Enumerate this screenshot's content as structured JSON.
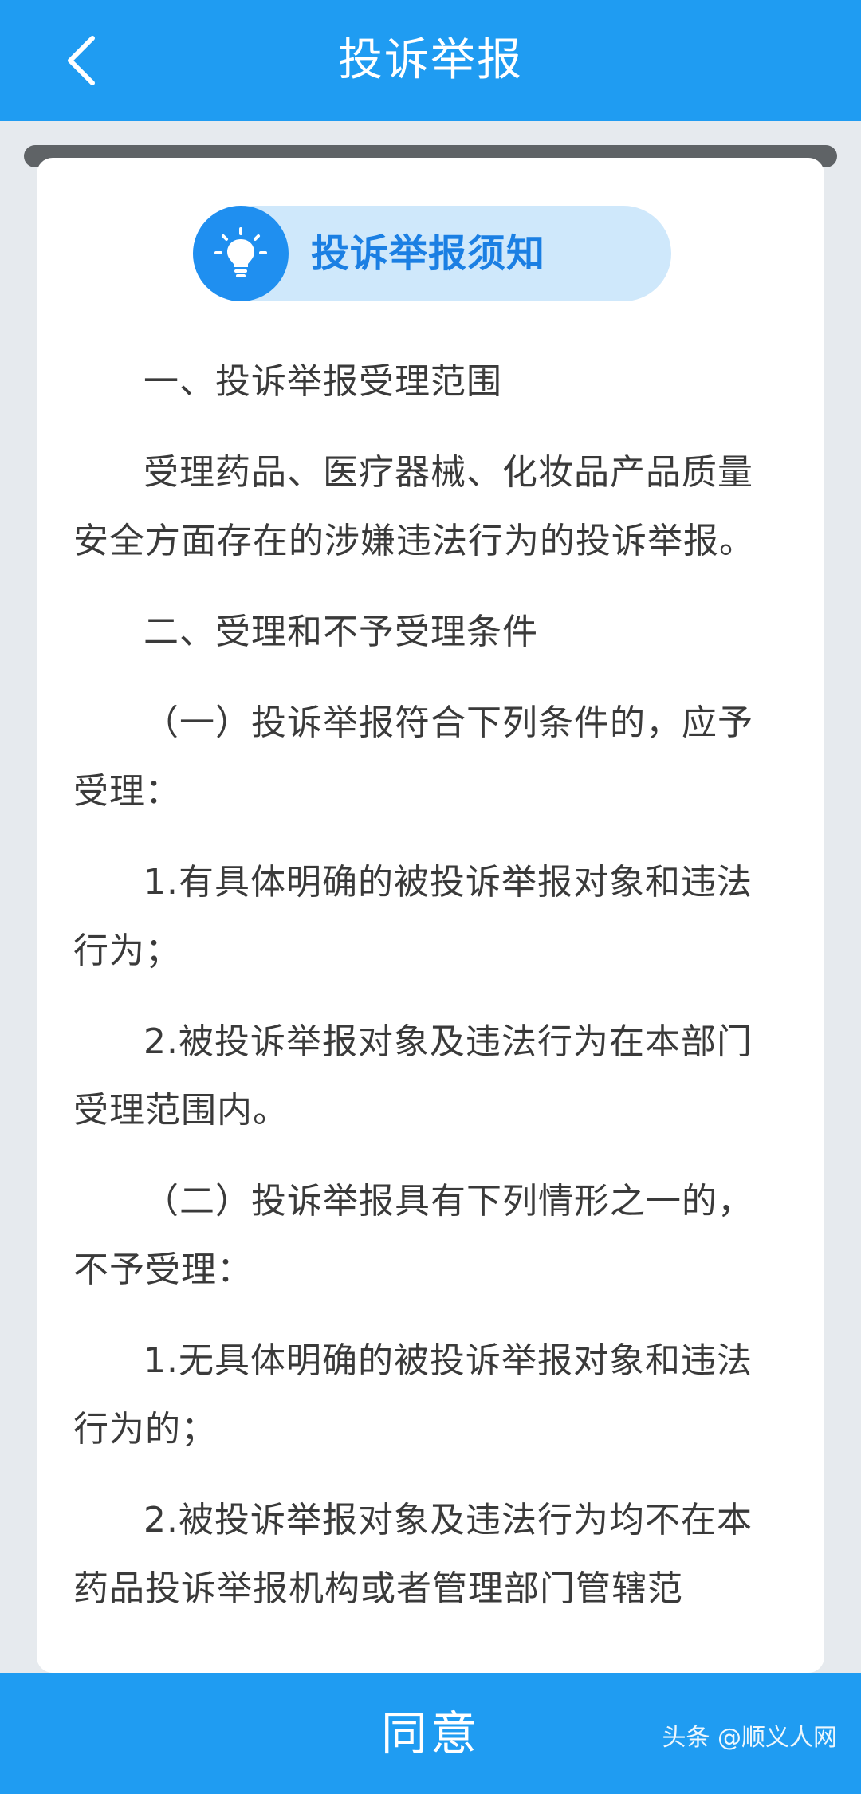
{
  "header": {
    "title": "投诉举报",
    "back_icon": "chevron-left-icon"
  },
  "notice": {
    "title": "投诉举报须知",
    "icon": "lightbulb-icon"
  },
  "content": {
    "paragraphs": [
      "一、投诉举报受理范围",
      "受理药品、医疗器械、化妆品产品质量安全方面存在的涉嫌违法行为的投诉举报。",
      "二、受理和不予受理条件",
      "（一）投诉举报符合下列条件的，应予受理：",
      "1.有具体明确的被投诉举报对象和违法行为；",
      "2.被投诉举报对象及违法行为在本部门受理范围内。",
      "（二）投诉举报具有下列情形之一的，不予受理：",
      "1.无具体明确的被投诉举报对象和违法行为的；",
      "2.被投诉举报对象及违法行为均不在本药品投诉举报机构或者管理部门管辖范"
    ]
  },
  "footer": {
    "agree_label": "同意",
    "watermark": "头条 @顺义人网"
  },
  "colors": {
    "primary": "#1f9cf2",
    "pill_bg": "#cfe8fb",
    "pill_text": "#1b7fe3",
    "body_text": "#3a3a3a",
    "page_bg": "#e6eaee"
  }
}
